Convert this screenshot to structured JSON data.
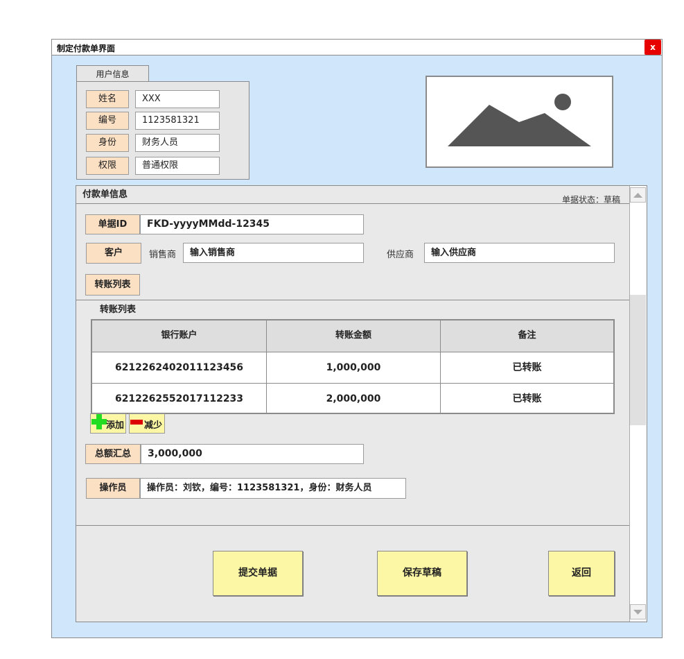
{
  "window": {
    "title": "制定付款单界面",
    "close_label": "x"
  },
  "user_info": {
    "tab_label": "用户信息",
    "fields": [
      {
        "label": "姓名",
        "value": "XXX"
      },
      {
        "label": "编号",
        "value": "1123581321"
      },
      {
        "label": "身份",
        "value": "财务人员"
      },
      {
        "label": "权限",
        "value": "普通权限"
      }
    ]
  },
  "payment": {
    "title": "付款单信息",
    "status": "单据状态：草稿",
    "doc_id_label": "单据ID",
    "doc_id_value": "FKD-yyyyMMdd-12345",
    "customer_label": "客户",
    "seller_label": "销售商",
    "seller_placeholder": "输入销售商",
    "supplier_label": "供应商",
    "supplier_placeholder": "输入供应商",
    "transfer_button": "转账列表",
    "transfer_section_title": "转账列表",
    "table": {
      "headers": [
        "银行账户",
        "转账金额",
        "备注"
      ],
      "rows": [
        [
          "6212262402011123456",
          "1,000,000",
          "已转账"
        ],
        [
          "6212262552017112233",
          "2,000,000",
          "已转账"
        ]
      ]
    },
    "add_label": "添加",
    "remove_label": "减少",
    "total_label": "总额汇总",
    "total_value": "3,000,000",
    "operator_label": "操作员",
    "operator_value": "操作员：刘钦，编号：1123581321，身份：财务人员",
    "actions": {
      "submit": "提交单据",
      "save_draft": "保存草稿",
      "back": "返回"
    }
  },
  "colors": {
    "window_bg": "#cfe6fb",
    "label_bg": "#fce0c4",
    "button_bg": "#fcf7a4",
    "close_bg": "#e60000",
    "add_icon": "#22dd22",
    "remove_icon": "#dd0000"
  },
  "icons": [
    "close-icon",
    "image-placeholder-icon",
    "plus-icon",
    "minus-icon",
    "scroll-up-icon",
    "scroll-down-icon"
  ]
}
